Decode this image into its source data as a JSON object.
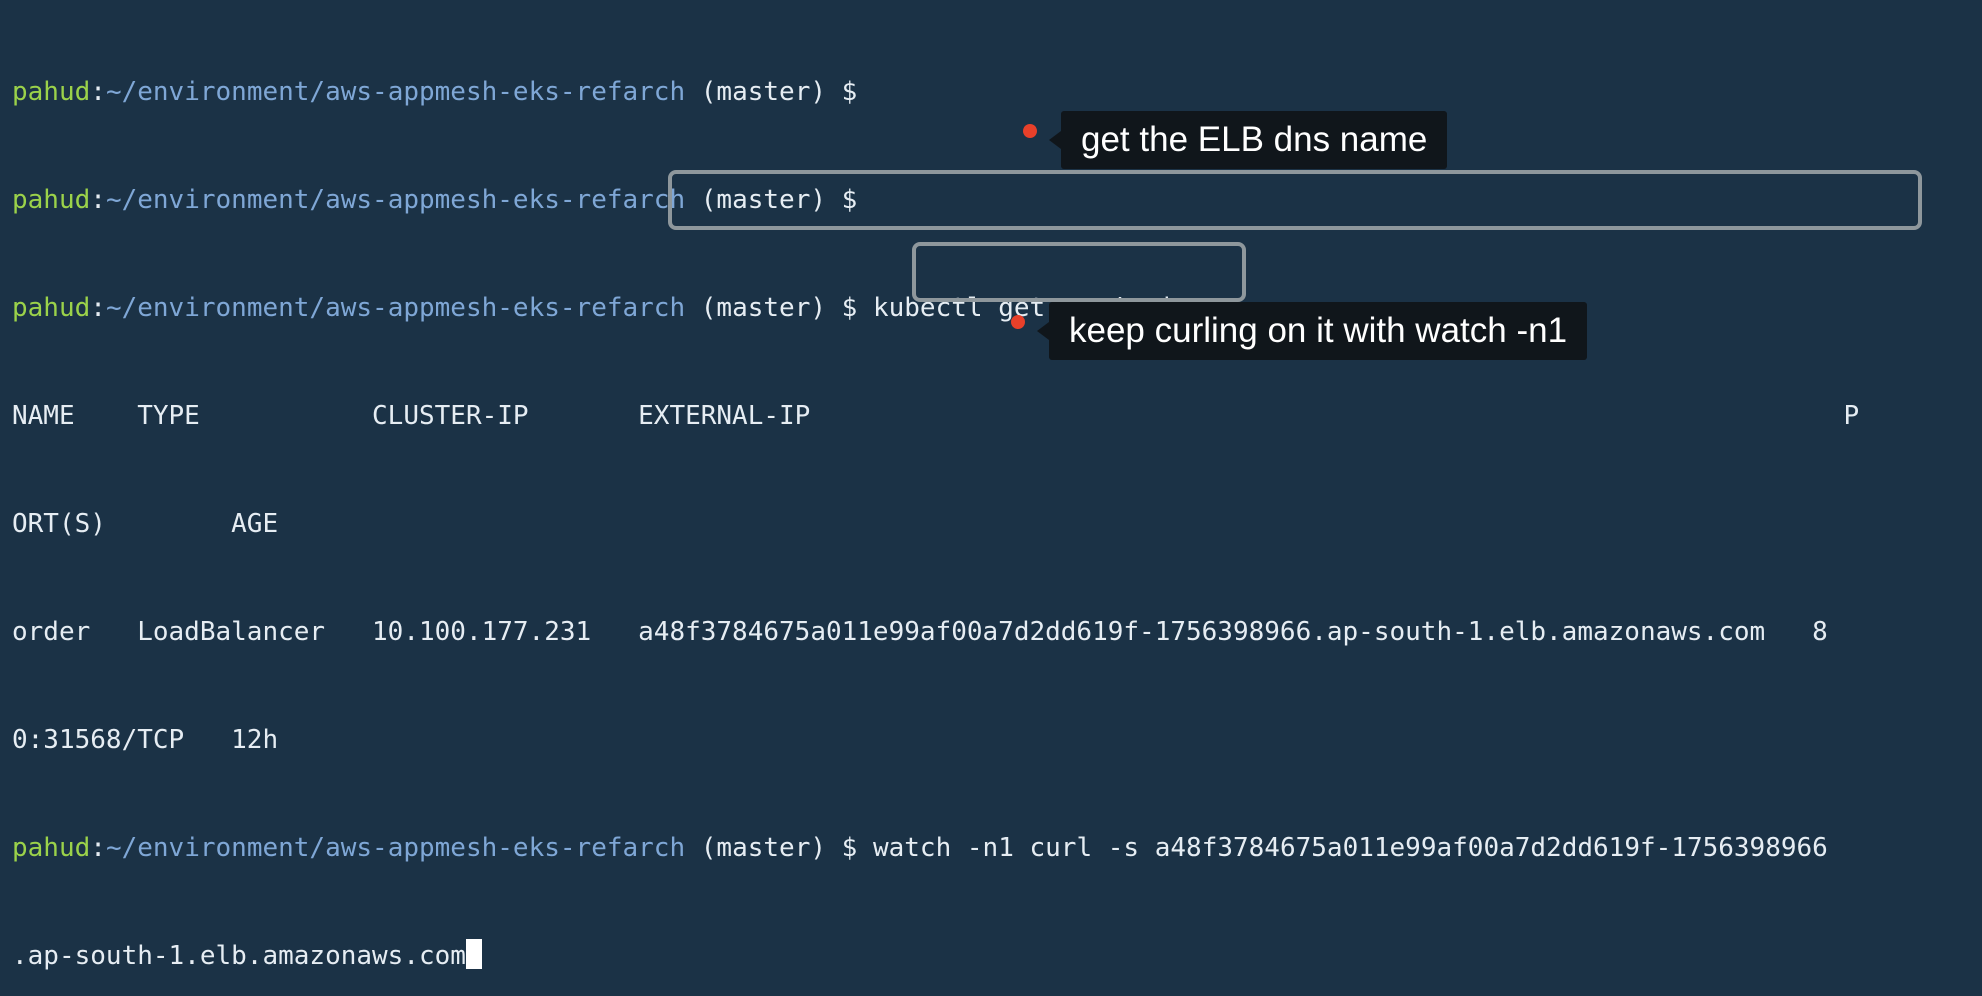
{
  "prompt": {
    "user": "pahud",
    "sep": ":",
    "path": "~/environment/aws-appmesh-eks-refarch",
    "branch": " (master) $ "
  },
  "commands": {
    "get_svc": "kubectl get svc/order",
    "watch_prefix": "watch -n1 curl -s a48f3784675a011e99af00a7d2dd619f-1756398966",
    "watch_suffix": ".ap-south-1.elb.amazonaws.com"
  },
  "output": {
    "header_line1": "NAME    TYPE           CLUSTER-IP       EXTERNAL-IP                                                                  P",
    "header_line2": "ORT(S)        AGE",
    "row_line1": "order   LoadBalancer   10.100.177.231   a48f3784675a011e99af00a7d2dd619f-1756398966.ap-south-1.elb.amazonaws.com   8",
    "row_line2": "0:31568/TCP   12h"
  },
  "annotations": {
    "elb_callout": "get the ELB dns name",
    "watch_callout": "keep curling on it with watch -n1"
  },
  "colors": {
    "background": "#1b3246",
    "user": "#9bd24a",
    "path": "#7fa7d6",
    "text": "#e6edf3",
    "box": "#8e979c",
    "dot": "#e8402a",
    "callout_bg": "#10161b"
  }
}
